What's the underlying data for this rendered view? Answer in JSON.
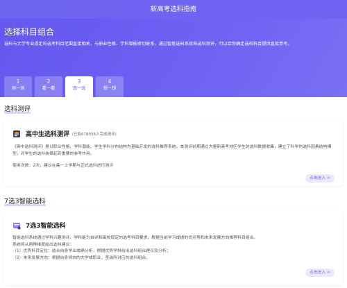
{
  "header": {
    "title": "新高考选科指南"
  },
  "hero": {
    "title": "选择科目组合",
    "description": "选科与大学专业规定的选考科目范围直接相关，与职业性格、学科潜能密切联系，通过智能选科系统和选科测评，可以给你确定选科科目提供直接参考。"
  },
  "tabs": [
    {
      "num": "1",
      "label": "测一测",
      "active": false
    },
    {
      "num": "2",
      "label": "看一看",
      "active": false
    },
    {
      "num": "3",
      "label": "选一选",
      "active": true
    },
    {
      "num": "4",
      "label": "想一想",
      "active": false
    }
  ],
  "section1": {
    "title": "选科测评",
    "card": {
      "name": "高中生选科测评",
      "note": "(已有678558人完成测评)",
      "desc": "《高中选科测评》是以职业性格、学科潜能、学生学科分布结构为基础开发的选科推荐系统。本测评前期通过大量新高考地区学生的选科数据收集，建立了科学的选科因素结构模型，对学生的选科抉择起到重要的参考作用。",
      "usage": "使用次数：2次，建议在高一上学期与正式选科进行测评",
      "button": "点击进入 >"
    }
  },
  "section2": {
    "title": "7选3智能选科",
    "card": {
      "name": "7选3智能选科",
      "lines": [
        "智能选科系统通过学科兴趣测评、学科能力自评和高校规定的选考科目要求，根据当前学习成绩的优劣势和未来发展方向推荐科目组合。",
        "系统将从两种维度给出选科建议：",
        "（1）优势科目定位：结合自身学业成绩分析，根据优势学科给出选科组合建议及分析；",
        "（2）未来发展方向：根据自身倾向的大学或职业，查询所对应的选科组合。"
      ],
      "button": "点击进入 >"
    }
  },
  "colors": {
    "accent": "#6d62f3",
    "icon_orange": "#f5a623",
    "icon_purple": "#8a7ff5"
  },
  "icons": {
    "card1": "test-icon",
    "card2": "smart-select-icon"
  }
}
